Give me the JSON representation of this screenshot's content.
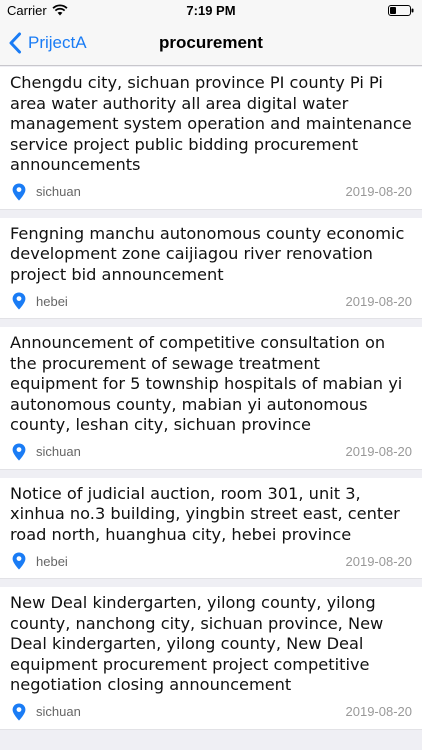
{
  "status_bar": {
    "carrier": "Carrier",
    "time": "7:19 PM"
  },
  "nav": {
    "back_label": "PrijectA",
    "title": "procurement"
  },
  "colors": {
    "accent": "#1a7cf5",
    "background": "#efeff4"
  },
  "items": [
    {
      "title": "Chengdu city, sichuan province PI county Pi Pi area water authority all area digital water management system operation and maintenance service project public bidding procurement announcements",
      "location": "sichuan",
      "date": "2019-08-20"
    },
    {
      "title": "Fengning manchu autonomous county economic development zone caijiagou river renovation project bid announcement",
      "location": "hebei",
      "date": "2019-08-20"
    },
    {
      "title": "Announcement of competitive consultation on the procurement of sewage treatment equipment for 5 township hospitals of mabian yi autonomous county, mabian yi autonomous county, leshan city, sichuan province",
      "location": "sichuan",
      "date": "2019-08-20"
    },
    {
      "title": "Notice of judicial auction, room 301, unit 3, xinhua no.3 building, yingbin street east, center road north, huanghua city, hebei province",
      "location": "hebei",
      "date": "2019-08-20"
    },
    {
      "title": "New Deal kindergarten, yilong county, yilong county, nanchong city, sichuan province, New Deal kindergarten, yilong county, New Deal equipment procurement project competitive negotiation closing announcement",
      "location": "sichuan",
      "date": "2019-08-20"
    }
  ]
}
